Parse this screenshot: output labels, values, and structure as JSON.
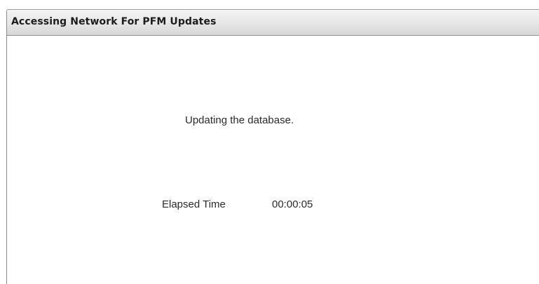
{
  "dialog": {
    "title": "Accessing Network For PFM Updates",
    "status_message": "Updating the database.",
    "elapsed": {
      "label": "Elapsed Time",
      "value": "00:00:05"
    }
  }
}
